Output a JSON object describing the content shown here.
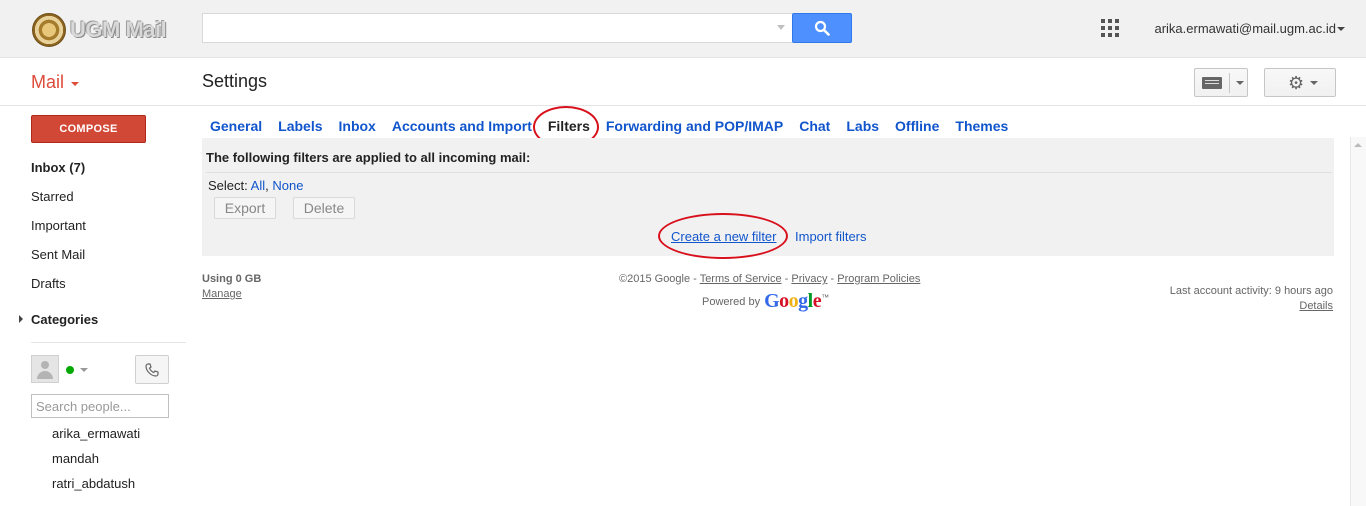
{
  "header": {
    "logo_text": "UGM Mail",
    "search": {
      "value": "",
      "placeholder": ""
    },
    "account_email": "arika.ermawati@mail.ugm.ac.id"
  },
  "mailbar": {
    "app_label": "Mail",
    "page_title": "Settings"
  },
  "sidebar": {
    "compose_label": "COMPOSE",
    "items": [
      {
        "label": "Inbox (7)"
      },
      {
        "label": "Starred"
      },
      {
        "label": "Important"
      },
      {
        "label": "Sent Mail"
      },
      {
        "label": "Drafts"
      }
    ],
    "categories_label": "Categories",
    "people_search_placeholder": "Search people...",
    "contacts": [
      "arika_ermawati",
      "mandah",
      "ratri_abdatush"
    ]
  },
  "settings": {
    "tabs": [
      {
        "label": "General"
      },
      {
        "label": "Labels"
      },
      {
        "label": "Inbox"
      },
      {
        "label": "Accounts and Import"
      },
      {
        "label": "Filters",
        "active": true
      },
      {
        "label": "Forwarding and POP/IMAP"
      },
      {
        "label": "Chat"
      },
      {
        "label": "Labs"
      },
      {
        "label": "Offline"
      },
      {
        "label": "Themes"
      }
    ],
    "filters": {
      "heading": "The following filters are applied to all incoming mail:",
      "select_label": "Select:",
      "select_all": "All",
      "select_none": "None",
      "export_label": "Export",
      "delete_label": "Delete",
      "create_filter_label": "Create a new filter",
      "import_filters_label": "Import filters"
    }
  },
  "footer": {
    "storage_used": "Using 0 GB",
    "manage_label": "Manage",
    "copyright": "©2015 Google",
    "terms_label": "Terms of Service",
    "privacy_label": "Privacy",
    "policies_label": "Program Policies",
    "powered_by": "Powered by",
    "google_wordmark": "Google",
    "trademark": "™",
    "last_activity": "Last account activity: 9 hours ago",
    "details_label": "Details"
  },
  "colors": {
    "accent_red": "#dd4b39",
    "compose_red": "#d14836",
    "link_blue": "#1155cc",
    "search_blue": "#4d90fe",
    "annotation_red": "#d8101c",
    "online_green": "#00aa00"
  }
}
